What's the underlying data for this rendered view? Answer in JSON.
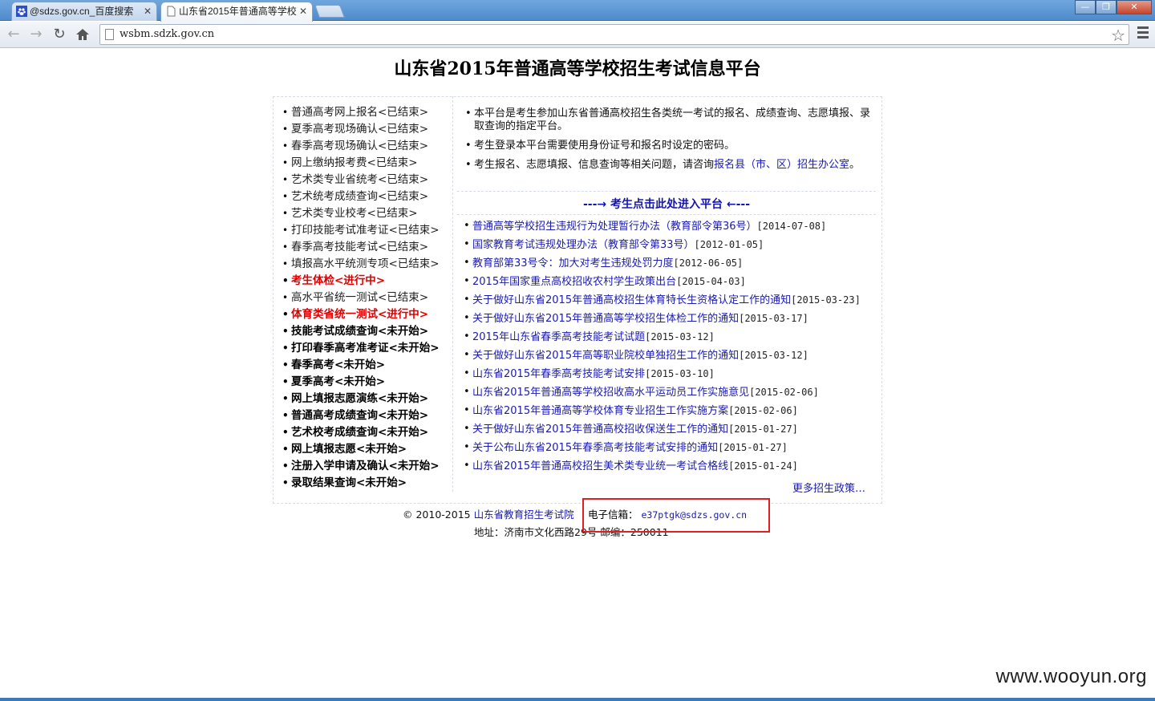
{
  "browser": {
    "tabs": [
      {
        "title": "@sdzs.gov.cn_百度搜索",
        "active": false
      },
      {
        "title": "山东省2015年普通高等学校",
        "active": true
      }
    ],
    "url": "wsbm.sdzk.gov.cn",
    "window_buttons": {
      "minimize": "—",
      "restore": "❐",
      "close": "✕"
    }
  },
  "page": {
    "title": "山东省2015年普通高等学校招生考试信息平台",
    "left_items": [
      {
        "label": "普通高考网上报名<已结束>",
        "status": "done"
      },
      {
        "label": "夏季高考现场确认<已结束>",
        "status": "done"
      },
      {
        "label": "春季高考现场确认<已结束>",
        "status": "done"
      },
      {
        "label": "网上缴纳报考费<已结束>",
        "status": "done"
      },
      {
        "label": "艺术类专业省统考<已结束>",
        "status": "done"
      },
      {
        "label": "艺术统考成绩查询<已结束>",
        "status": "done"
      },
      {
        "label": "艺术类专业校考<已结束>",
        "status": "done"
      },
      {
        "label": "打印技能考试准考证<已结束>",
        "status": "done"
      },
      {
        "label": "春季高考技能考试<已结束>",
        "status": "done"
      },
      {
        "label": "填报高水平统测专项<已结束>",
        "status": "done"
      },
      {
        "label": "考生体检<进行中>",
        "status": "ongoing"
      },
      {
        "label": "高水平省统一测试<已结束>",
        "status": "done"
      },
      {
        "label": "体育类省统一测试<进行中>",
        "status": "ongoing"
      },
      {
        "label": "技能考试成绩查询<未开始>",
        "status": "pending"
      },
      {
        "label": "打印春季高考准考证<未开始>",
        "status": "pending"
      },
      {
        "label": "春季高考<未开始>",
        "status": "pending"
      },
      {
        "label": "夏季高考<未开始>",
        "status": "pending"
      },
      {
        "label": "网上填报志愿演练<未开始>",
        "status": "pending"
      },
      {
        "label": "普通高考成绩查询<未开始>",
        "status": "pending"
      },
      {
        "label": "艺术校考成绩查询<未开始>",
        "status": "pending"
      },
      {
        "label": "网上填报志愿<未开始>",
        "status": "pending"
      },
      {
        "label": "注册入学申请及确认<未开始>",
        "status": "pending"
      },
      {
        "label": "录取结果查询<未开始>",
        "status": "pending"
      }
    ],
    "notices": {
      "n1": "本平台是考生参加山东省普通高校招生各类统一考试的报名、成绩查询、志愿填报、录取查询的指定平台。",
      "n2": "考生登录本平台需要使用身份证号和报名时设定的密码。",
      "n3_prefix": "考生报名、志愿填报、信息查询等相关问题，请咨询",
      "n3_link": "报名县（市、区）招生办公室",
      "n3_suffix": "。"
    },
    "enter_link": "---→ 考生点击此处进入平台 ←---",
    "news": [
      {
        "title": "普通高等学校招生违规行为处理暂行办法（教育部令第36号）",
        "date": "[2014-07-08]"
      },
      {
        "title": "国家教育考试违规处理办法（教育部令第33号）",
        "date": "[2012-01-05]"
      },
      {
        "title": "教育部第33号令：加大对考生违规处罚力度",
        "date": "[2012-06-05]"
      },
      {
        "title": "2015年国家重点高校招收农村学生政策出台",
        "date": "[2015-04-03]"
      },
      {
        "title": "关于做好山东省2015年普通高校招生体育特长生资格认定工作的通知",
        "date": "[2015-03-23]"
      },
      {
        "title": "关于做好山东省2015年普通高等学校招生体检工作的通知",
        "date": "[2015-03-17]"
      },
      {
        "title": "2015年山东省春季高考技能考试试题",
        "date": "[2015-03-12]"
      },
      {
        "title": "关于做好山东省2015年高等职业院校单独招生工作的通知",
        "date": "[2015-03-12]"
      },
      {
        "title": "山东省2015年春季高考技能考试安排",
        "date": "[2015-03-10]"
      },
      {
        "title": "山东省2015年普通高等学校招收高水平运动员工作实施意见",
        "date": "[2015-02-06]"
      },
      {
        "title": "山东省2015年普通高等学校体育专业招生工作实施方案",
        "date": "[2015-02-06]"
      },
      {
        "title": "关于做好山东省2015年普通高校招收保送生工作的通知",
        "date": "[2015-01-27]"
      },
      {
        "title": "关于公布山东省2015年春季高考技能考试安排的通知",
        "date": "[2015-01-27]"
      },
      {
        "title": "山东省2015年普通高校招生美术类专业统一考试合格线",
        "date": "[2015-01-24]"
      }
    ],
    "more": "更多招生政策…",
    "footer": {
      "copyright": "© 2010-2015",
      "org": "山东省教育招生考试院",
      "email_label": "电子信箱：",
      "email": "e37ptgk@sdzs.gov.cn",
      "address": "地址：济南市文化西路29号 邮编：250011"
    }
  },
  "watermark": "www.wooyun.org",
  "colors": {
    "link": "#1a1ab0",
    "ongoing": "#e00000",
    "highlight_box": "#e02020"
  }
}
